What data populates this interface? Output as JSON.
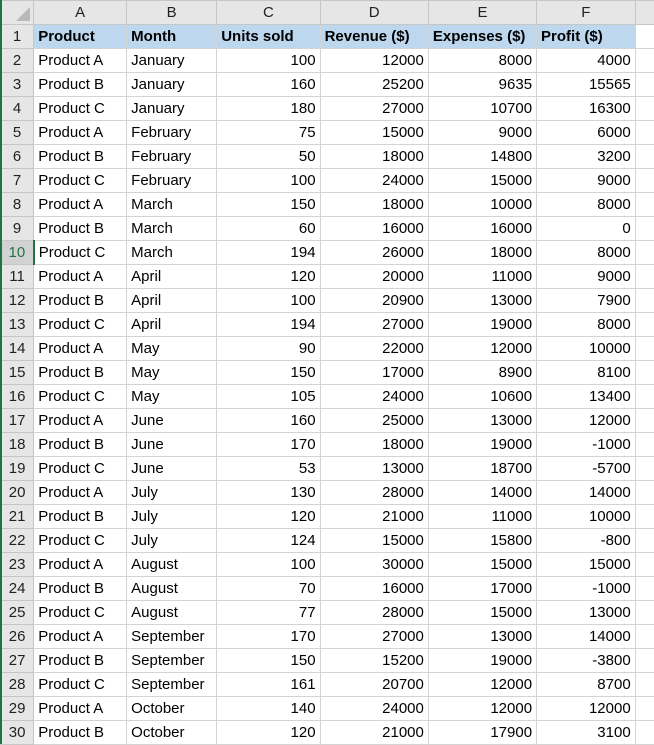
{
  "columns": [
    "A",
    "B",
    "C",
    "D",
    "E",
    "F"
  ],
  "headers": [
    "Product",
    "Month",
    "Units sold",
    "Revenue ($)",
    "Expenses ($)",
    "Profit ($)"
  ],
  "active_row": 10,
  "rows": [
    {
      "n": "2",
      "product": "Product A",
      "month": "January",
      "units": "100",
      "revenue": "12000",
      "expenses": "8000",
      "profit": "4000"
    },
    {
      "n": "3",
      "product": "Product B",
      "month": "January",
      "units": "160",
      "revenue": "25200",
      "expenses": "9635",
      "profit": "15565"
    },
    {
      "n": "4",
      "product": "Product C",
      "month": "January",
      "units": "180",
      "revenue": "27000",
      "expenses": "10700",
      "profit": "16300"
    },
    {
      "n": "5",
      "product": "Product A",
      "month": "February",
      "units": "75",
      "revenue": "15000",
      "expenses": "9000",
      "profit": "6000"
    },
    {
      "n": "6",
      "product": "Product B",
      "month": "February",
      "units": "50",
      "revenue": "18000",
      "expenses": "14800",
      "profit": "3200"
    },
    {
      "n": "7",
      "product": "Product C",
      "month": "February",
      "units": "100",
      "revenue": "24000",
      "expenses": "15000",
      "profit": "9000"
    },
    {
      "n": "8",
      "product": "Product A",
      "month": "March",
      "units": "150",
      "revenue": "18000",
      "expenses": "10000",
      "profit": "8000"
    },
    {
      "n": "9",
      "product": "Product B",
      "month": "March",
      "units": "60",
      "revenue": "16000",
      "expenses": "16000",
      "profit": "0"
    },
    {
      "n": "10",
      "product": "Product C",
      "month": "March",
      "units": "194",
      "revenue": "26000",
      "expenses": "18000",
      "profit": "8000"
    },
    {
      "n": "11",
      "product": "Product A",
      "month": "April",
      "units": "120",
      "revenue": "20000",
      "expenses": "11000",
      "profit": "9000"
    },
    {
      "n": "12",
      "product": "Product B",
      "month": "April",
      "units": "100",
      "revenue": "20900",
      "expenses": "13000",
      "profit": "7900"
    },
    {
      "n": "13",
      "product": "Product C",
      "month": "April",
      "units": "194",
      "revenue": "27000",
      "expenses": "19000",
      "profit": "8000"
    },
    {
      "n": "14",
      "product": "Product A",
      "month": "May",
      "units": "90",
      "revenue": "22000",
      "expenses": "12000",
      "profit": "10000"
    },
    {
      "n": "15",
      "product": "Product B",
      "month": "May",
      "units": "150",
      "revenue": "17000",
      "expenses": "8900",
      "profit": "8100"
    },
    {
      "n": "16",
      "product": "Product C",
      "month": "May",
      "units": "105",
      "revenue": "24000",
      "expenses": "10600",
      "profit": "13400"
    },
    {
      "n": "17",
      "product": "Product A",
      "month": "June",
      "units": "160",
      "revenue": "25000",
      "expenses": "13000",
      "profit": "12000"
    },
    {
      "n": "18",
      "product": "Product B",
      "month": "June",
      "units": "170",
      "revenue": "18000",
      "expenses": "19000",
      "profit": "-1000"
    },
    {
      "n": "19",
      "product": "Product C",
      "month": "June",
      "units": "53",
      "revenue": "13000",
      "expenses": "18700",
      "profit": "-5700"
    },
    {
      "n": "20",
      "product": "Product A",
      "month": "July",
      "units": "130",
      "revenue": "28000",
      "expenses": "14000",
      "profit": "14000"
    },
    {
      "n": "21",
      "product": "Product B",
      "month": "July",
      "units": "120",
      "revenue": "21000",
      "expenses": "11000",
      "profit": "10000"
    },
    {
      "n": "22",
      "product": "Product C",
      "month": "July",
      "units": "124",
      "revenue": "15000",
      "expenses": "15800",
      "profit": "-800"
    },
    {
      "n": "23",
      "product": "Product A",
      "month": "August",
      "units": "100",
      "revenue": "30000",
      "expenses": "15000",
      "profit": "15000"
    },
    {
      "n": "24",
      "product": "Product B",
      "month": "August",
      "units": "70",
      "revenue": "16000",
      "expenses": "17000",
      "profit": "-1000"
    },
    {
      "n": "25",
      "product": "Product C",
      "month": "August",
      "units": "77",
      "revenue": "28000",
      "expenses": "15000",
      "profit": "13000"
    },
    {
      "n": "26",
      "product": "Product A",
      "month": "September",
      "units": "170",
      "revenue": "27000",
      "expenses": "13000",
      "profit": "14000"
    },
    {
      "n": "27",
      "product": "Product B",
      "month": "September",
      "units": "150",
      "revenue": "15200",
      "expenses": "19000",
      "profit": "-3800"
    },
    {
      "n": "28",
      "product": "Product C",
      "month": "September",
      "units": "161",
      "revenue": "20700",
      "expenses": "12000",
      "profit": "8700"
    },
    {
      "n": "29",
      "product": "Product A",
      "month": "October",
      "units": "140",
      "revenue": "24000",
      "expenses": "12000",
      "profit": "12000"
    },
    {
      "n": "30",
      "product": "Product B",
      "month": "October",
      "units": "120",
      "revenue": "21000",
      "expenses": "17900",
      "profit": "3100"
    }
  ]
}
